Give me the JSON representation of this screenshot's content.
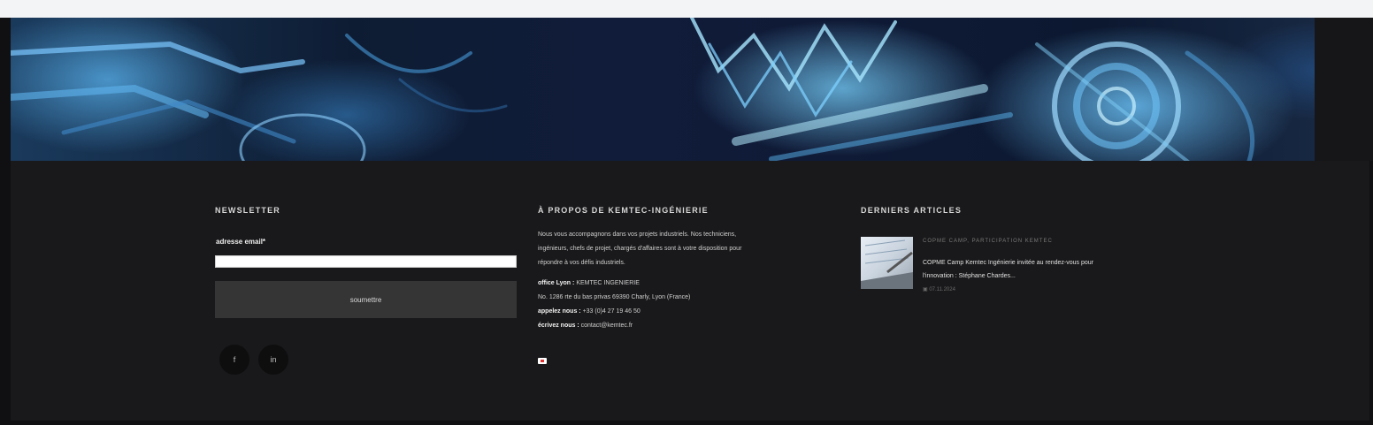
{
  "newsletter": {
    "title": "NEWSLETTER",
    "email_label": "adresse email*",
    "email_value": "",
    "submit_label": "soumettre"
  },
  "social": {
    "facebook": "f",
    "linkedin": "in"
  },
  "about": {
    "title": "À PROPOS DE KEMTEC-INGÉNIERIE",
    "description": [
      "Nous vous accompagnons dans vos projets industriels. Nos techniciens,",
      "ingénieurs, chefs de projet, chargés d'affaires sont à votre disposition pour",
      "répondre à vos défis industriels."
    ],
    "office_label": "office Lyon :",
    "office_value": "KEMTEC INGENIERIE",
    "address": "No. 1286 rte du bas privas 69390 Charly, Lyon (France)",
    "phone_label": "appelez nous :",
    "phone_value": "+33 (0)4 27 19 46 50",
    "email_label": "écrivez nous :",
    "email_value": "contact@kemtec.fr"
  },
  "articles": {
    "title": "DERNIERS ARTICLES",
    "items": [
      {
        "category": "COPME CAMP, PARTICIPATION KEMTEC",
        "title_line1": "COPME Camp Kemtec Ingénierie invitée au rendez-vous pour",
        "title_line2": "l'innovation : Stéphane Chardes...",
        "date": "07.11.2024"
      }
    ]
  },
  "colors": {
    "footer_bg": "#19191b",
    "button_bg": "#353536",
    "text": "#cfcfcf"
  }
}
